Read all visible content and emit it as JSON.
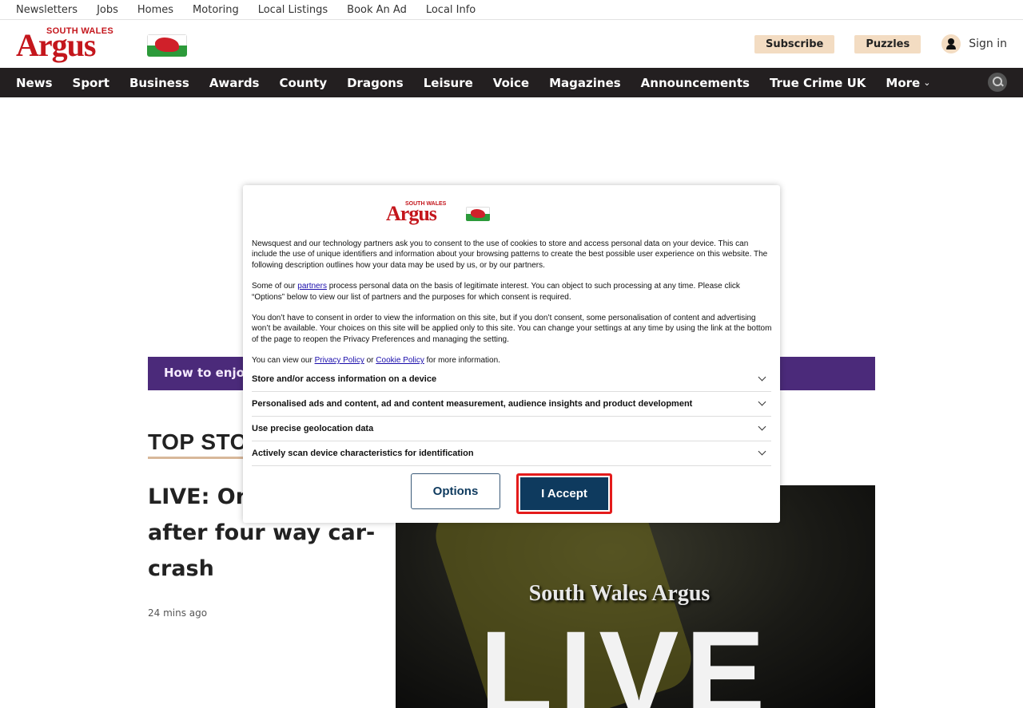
{
  "utility_links": [
    "Newsletters",
    "Jobs",
    "Homes",
    "Motoring",
    "Local Listings",
    "Book An Ad",
    "Local Info"
  ],
  "logo": {
    "top_text": "SOUTH WALES",
    "main_text": "Argus"
  },
  "header": {
    "subscribe": "Subscribe",
    "puzzles": "Puzzles",
    "sign_in": "Sign in"
  },
  "nav": {
    "items": [
      "News",
      "Sport",
      "Business",
      "Awards",
      "County",
      "Dragons",
      "Leisure",
      "Voice",
      "Magazines",
      "Announcements",
      "True Crime UK"
    ],
    "more": "More"
  },
  "page": {
    "promo_text": "How to enjoy",
    "section_heading": "TOP STO",
    "headline": "LIVE: One arrested after four way car-crash",
    "timestamp": "24 mins ago",
    "hero_brand": "South Wales Argus",
    "hero_word": "LIVE"
  },
  "consent": {
    "para1": "Newsquest and our technology partners ask you to consent to the use of cookies to store and access personal data on your device. This can include the use of unique identifiers and information about your browsing patterns to create the best possible user experience on this website. The following description outlines how your data may be used by us, or by our partners.",
    "para2_pre": "Some of our ",
    "para2_link": "partners",
    "para2_post": " process personal data on the basis of legitimate interest. You can object to such processing at any time. Please click “Options” below to view our list of partners and the purposes for which consent is required.",
    "para3": "You don’t have to consent in order to view the information on this site, but if you don’t consent, some personalisation of content and advertising won’t be available. Your choices on this site will be applied only to this site. You can change your settings at any time by using the link at the bottom of the page to reopen the Privacy Preferences and managing the setting.",
    "para4_pre": "You can view our ",
    "privacy_link": "Privacy Policy",
    "para4_mid": " or ",
    "cookie_link": "Cookie Policy",
    "para4_post": " for more information.",
    "purposes": [
      "Store and/or access information on a device",
      "Personalised ads and content, ad and content measurement, audience insights and product development",
      "Use precise geolocation data",
      "Actively scan device characteristics for identification"
    ],
    "options_label": "Options",
    "accept_label": "I Accept"
  }
}
